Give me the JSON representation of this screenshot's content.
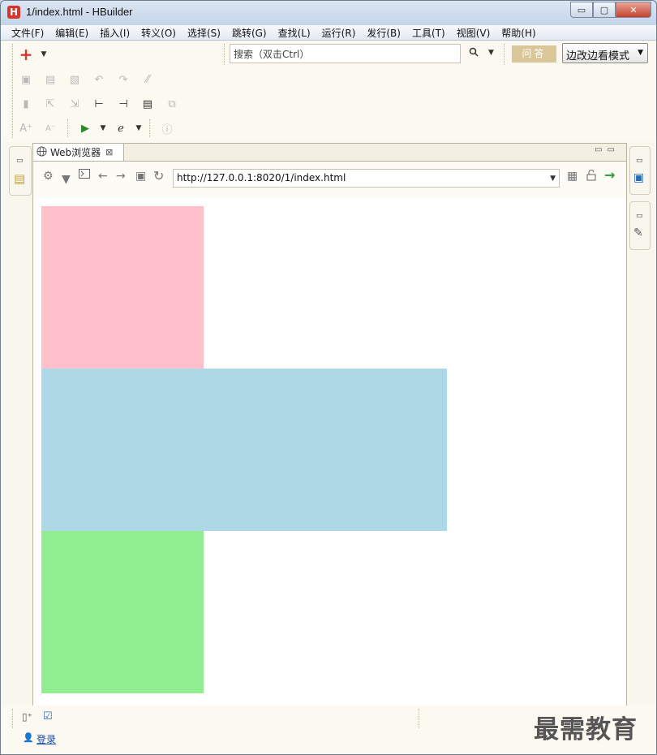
{
  "window": {
    "title": "1/index.html  -  HBuilder",
    "app_icon": "H",
    "controls": {
      "minimize": "▭",
      "maximize": "▢",
      "close": "✕"
    }
  },
  "menu": [
    "文件(F)",
    "编辑(E)",
    "插入(I)",
    "转义(O)",
    "选择(S)",
    "跳转(G)",
    "查找(L)",
    "运行(R)",
    "发行(B)",
    "工具(T)",
    "视图(V)",
    "帮助(H)"
  ],
  "toolbar": {
    "search_placeholder": "搜索（双击Ctrl）",
    "ask_label": "问答",
    "mode_label": "边改边看模式",
    "add_glyph": "+"
  },
  "browser": {
    "tab_label": "Web浏览器",
    "url": "http://127.0.0.1:8020/1/index.html"
  },
  "page_boxes": [
    {
      "name": "pink-box",
      "color": "#ffc0cb"
    },
    {
      "name": "lightblue-box",
      "color": "#add8e6"
    },
    {
      "name": "lightgreen-box",
      "color": "#90ee90"
    }
  ],
  "bottom": {
    "login_label": "登录",
    "watermark": "最需教育"
  },
  "icons": {
    "save": "save-icon",
    "globe": "globe-icon",
    "settings": "gear-icon",
    "terminal": "terminal-icon",
    "back": "back-arrow-icon",
    "forward": "forward-arrow-icon",
    "stop": "stop-icon",
    "refresh": "refresh-icon",
    "qr": "qr-code-icon",
    "lock": "lock-icon",
    "go": "go-arrow-icon",
    "user": "user-icon"
  }
}
